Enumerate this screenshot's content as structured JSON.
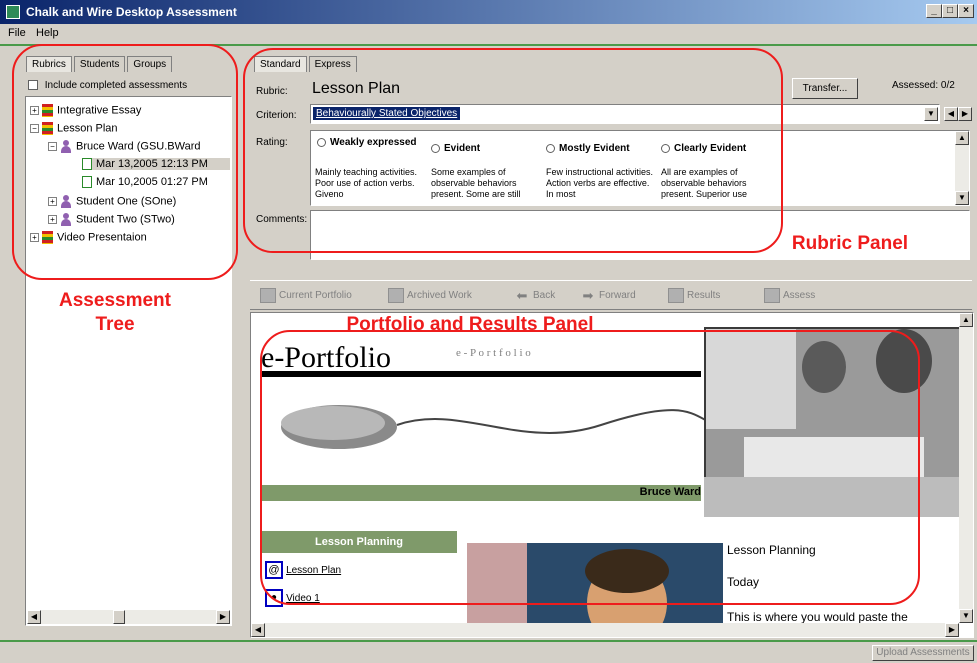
{
  "window": {
    "title": "Chalk and Wire Desktop Assessment",
    "minimize": "_",
    "maximize": "□",
    "close": "×"
  },
  "menu": {
    "file": "File",
    "help": "Help"
  },
  "left_tabs": [
    "Rubrics",
    "Students",
    "Groups"
  ],
  "include_completed_label": "Include completed assessments",
  "tree": {
    "integrative_essay": "Integrative Essay",
    "lesson_plan": "Lesson Plan",
    "bruce_ward": "Bruce Ward (GSU.BWard",
    "entry1": "Mar 13,2005 12:13 PM",
    "entry2": "Mar 10,2005 01:27 PM",
    "student_one": "Student One (SOne)",
    "student_two": "Student Two (STwo)",
    "video_presentation": "Video Presentaion"
  },
  "annotations": {
    "assessment_tree_l1": "Assessment",
    "assessment_tree_l2": "Tree",
    "rubric_panel": "Rubric Panel",
    "portfolio_panel": "Portfolio and Results Panel"
  },
  "rubric_tabs": [
    "Standard",
    "Express"
  ],
  "rubric": {
    "rubric_label": "Rubric:",
    "rubric_name": "Lesson Plan",
    "transfer_button": "Transfer...",
    "assessed": "Assessed: 0/2",
    "criterion_label": "Criterion:",
    "criterion_value": "Behaviourally Stated Objectives",
    "rating_label": "Rating:",
    "comments_label": "Comments:",
    "ratings": [
      {
        "name": "Weakly expressed",
        "desc": "Mainly teaching activities. Poor use of action verbs. Giveno"
      },
      {
        "name": "Evident",
        "desc": "Some examples of observable behaviors present. Some are still"
      },
      {
        "name": "Mostly Evident",
        "desc": "Few instructional activities. Action verbs are effective. In most"
      },
      {
        "name": "Clearly Evident",
        "desc": "All are examples of observable behaviors present. Superior use"
      }
    ]
  },
  "portfolio_toolbar": [
    "Current Portfolio",
    "Archived Work",
    "Back",
    "Forward",
    "Results",
    "Assess"
  ],
  "portfolio": {
    "title_big": "e-Portfolio",
    "title_spaced": "e - P o r t f o l i o",
    "owner": "Bruce Ward",
    "nav_header": "Lesson Planning",
    "link1": "Lesson Plan",
    "link2": "Video 1",
    "side_text1": "Lesson Planning",
    "side_text2": "Today",
    "side_text3": "This is where you would paste the"
  },
  "status": {
    "upload_button": "Upload Assessments"
  },
  "colors": {
    "accent_red": "#ee1c1c",
    "title_blue": "#0a246a",
    "green_band": "#7f9a6a"
  }
}
